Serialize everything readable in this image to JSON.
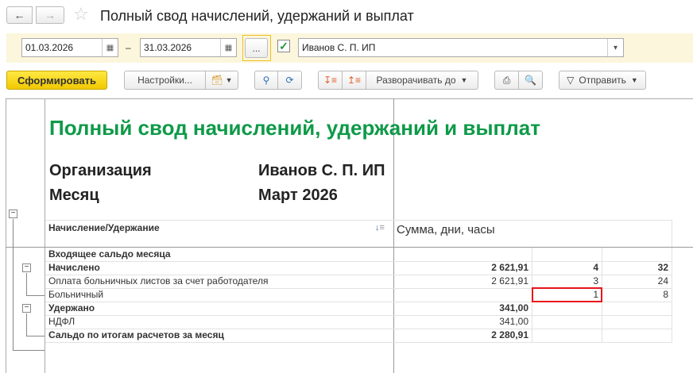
{
  "window": {
    "title": "Полный свод начислений, удержаний и выплат"
  },
  "filters": {
    "date_from": "01.03.2026",
    "date_to": "31.03.2026",
    "dash": "–",
    "period_button": "...",
    "org_checked": true,
    "organization": "Иванов С. П. ИП"
  },
  "toolbar": {
    "generate": "Сформировать",
    "settings": "Настройки...",
    "expand_to": "Разворачивать до",
    "send": "Отправить"
  },
  "report": {
    "title": "Полный свод начислений, удержаний и выплат",
    "org_label": "Организация",
    "org_value": "Иванов С. П. ИП",
    "month_label": "Месяц",
    "month_value": "Март 2026",
    "col_header_1": "Начисление/Удержание",
    "col_header_2": "Сумма, дни, часы",
    "rows": [
      {
        "label": "Входящее сальдо месяца",
        "sum": "",
        "days": "",
        "hours": "",
        "bold": true
      },
      {
        "label": "Начислено",
        "sum": "2 621,91",
        "days": "4",
        "hours": "32",
        "bold": true
      },
      {
        "label": "Оплата больничных листов за счет работодателя",
        "sum": "2 621,91",
        "days": "3",
        "hours": "24",
        "bold": false
      },
      {
        "label": "Больничный",
        "sum": "",
        "days": "1",
        "hours": "8",
        "bold": false
      },
      {
        "label": "Удержано",
        "sum": "341,00",
        "days": "",
        "hours": "",
        "bold": true
      },
      {
        "label": "НДФЛ",
        "sum": "341,00",
        "days": "",
        "hours": "",
        "bold": false
      },
      {
        "label": "Сальдо по итогам расчетов за месяц",
        "sum": "2 280,91",
        "days": "",
        "hours": "",
        "bold": true
      }
    ]
  },
  "colors": {
    "accent_yellow": "#f5d400",
    "title_green": "#0e9a48",
    "highlight_red": "#e8141c",
    "filter_bg": "#fbf6dc"
  }
}
